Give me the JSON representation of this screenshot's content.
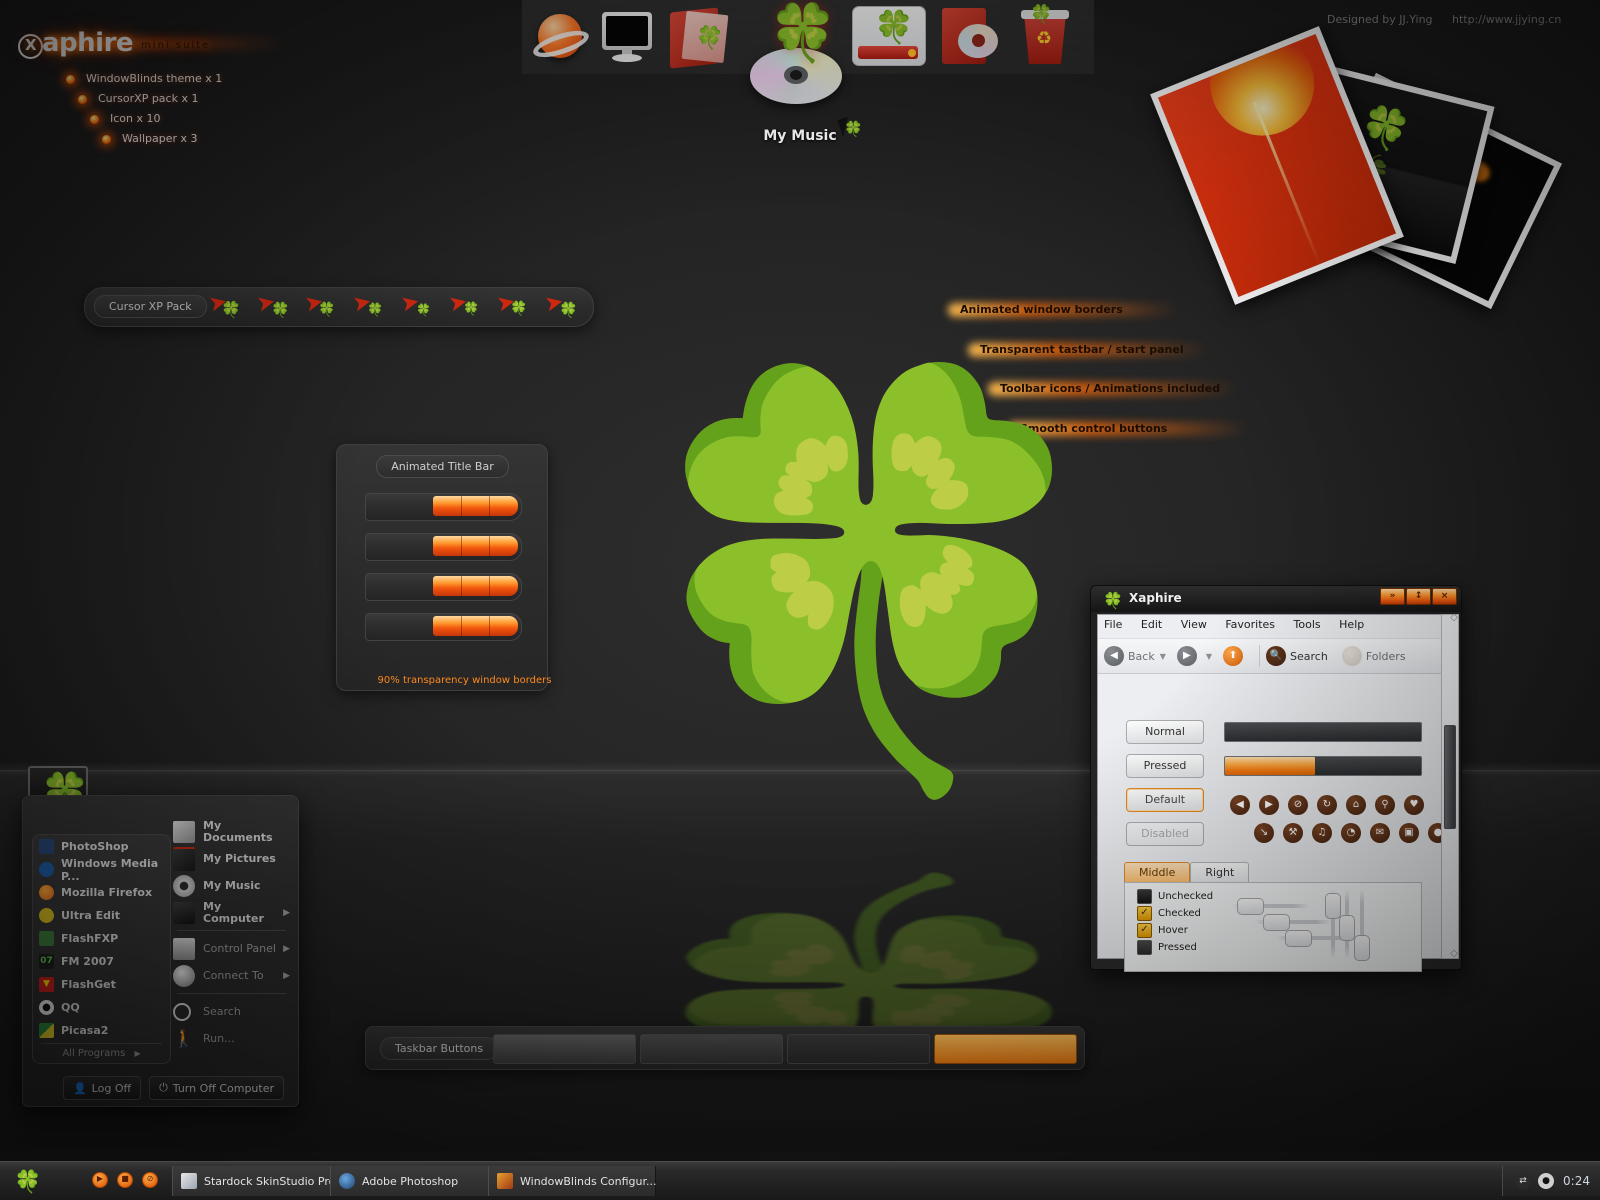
{
  "branding": {
    "logo_mark": "X",
    "logo_text": "aphire",
    "tagline": "mini suite",
    "items": [
      {
        "label": "WindowBlinds theme x 1"
      },
      {
        "label": "CursorXP pack x 1"
      },
      {
        "label": "Icon x 10"
      },
      {
        "label": "Wallpaper x 3"
      }
    ]
  },
  "credits": {
    "designer": "Designed by JJ.Ying",
    "url": "http://www.jjying.cn"
  },
  "icon_strip": {
    "icons": [
      {
        "name": "globe-icon",
        "glyph": "●"
      },
      {
        "name": "monitor-icon",
        "glyph": "■"
      },
      {
        "name": "folder-documents-icon",
        "glyph": "▰"
      },
      {
        "name": "cd-flame-icon",
        "glyph": "●"
      },
      {
        "name": "hard-drive-icon",
        "glyph": "▬"
      },
      {
        "name": "disc-folder-icon",
        "glyph": "●"
      },
      {
        "name": "recycle-bin-icon",
        "glyph": "♻"
      }
    ],
    "selected_label": "My Music"
  },
  "cursor_panel": {
    "title": "Cursor XP Pack",
    "count": 8
  },
  "title_bar_panel": {
    "title": "Animated Title Bar",
    "rows": 4,
    "note": "90% transparency window borders"
  },
  "callouts": [
    {
      "text": "Animated window borders"
    },
    {
      "text": "Transparent tastbar / start panel"
    },
    {
      "text": "Toolbar icons / Animations included"
    },
    {
      "text": "Smooth control buttons"
    }
  ],
  "explorer_window": {
    "title": "Xaphire",
    "caption_buttons": [
      {
        "name": "minimize-button",
        "glyph": "»"
      },
      {
        "name": "maximize-button",
        "glyph": "↕"
      },
      {
        "name": "close-button",
        "glyph": "×"
      }
    ],
    "menu": [
      "File",
      "Edit",
      "View",
      "Favorites",
      "Tools",
      "Help"
    ],
    "toolbar": {
      "back": "Back",
      "search": "Search",
      "folders": "Folders"
    },
    "state_buttons": [
      "Normal",
      "Pressed",
      "Default",
      "Disabled"
    ],
    "progress": {
      "empty_value": 0,
      "filled_value": 46
    },
    "toolbar_icons_row1": [
      {
        "name": "back-icon",
        "glyph": "◀"
      },
      {
        "name": "forward-icon",
        "glyph": "▶"
      },
      {
        "name": "stop-icon",
        "glyph": "⊘"
      },
      {
        "name": "refresh-icon",
        "glyph": "↻"
      },
      {
        "name": "home-icon",
        "glyph": "⌂"
      },
      {
        "name": "search-icon",
        "glyph": "⚲"
      },
      {
        "name": "favorites-icon",
        "glyph": "♥"
      }
    ],
    "toolbar_icons_row2": [
      {
        "name": "history-icon",
        "glyph": "↘"
      },
      {
        "name": "tools-icon",
        "glyph": "⚒"
      },
      {
        "name": "music-icon",
        "glyph": "♫"
      },
      {
        "name": "clock-icon",
        "glyph": "◔"
      },
      {
        "name": "mail-icon",
        "glyph": "✉"
      },
      {
        "name": "window-icon",
        "glyph": "▣"
      },
      {
        "name": "chat-icon",
        "glyph": "●"
      }
    ],
    "tabs": [
      {
        "label": "Middle",
        "active": true
      },
      {
        "label": "Right",
        "active": false
      }
    ],
    "checkbox_states": [
      {
        "label": "Unchecked",
        "checked": false,
        "style": "off"
      },
      {
        "label": "Checked",
        "checked": true,
        "style": "on"
      },
      {
        "label": "Hover",
        "checked": true,
        "style": "hover"
      },
      {
        "label": "Pressed",
        "checked": false,
        "style": "pressed"
      }
    ]
  },
  "start_menu": {
    "programs": [
      {
        "label": "PhotoShop",
        "color": "#2a4a7a"
      },
      {
        "label": "Windows Media P...",
        "color": "#1d5fa8"
      },
      {
        "label": "Mozilla Firefox",
        "color": "#e8651a"
      },
      {
        "label": "Ultra Edit",
        "color": "#d8c020"
      },
      {
        "label": "FlashFXP",
        "color": "#3f7f3f"
      },
      {
        "label": "FM 2007",
        "color": "#1f1f1f"
      },
      {
        "label": "FlashGet",
        "color": "#cf2020"
      },
      {
        "label": "QQ",
        "color": "#f0f0f0"
      },
      {
        "label": "Picasa2",
        "color": "#2e8b3e"
      }
    ],
    "all_programs": "All Programs",
    "places": [
      {
        "label": "My Documents",
        "icon": "documents-icon",
        "arrow": false,
        "dim": false
      },
      {
        "label": "My Pictures",
        "icon": "pictures-icon",
        "arrow": false,
        "dim": false
      },
      {
        "label": "My Music",
        "icon": "music-icon",
        "arrow": false,
        "dim": false
      },
      {
        "label": "My Computer",
        "icon": "computer-icon",
        "arrow": true,
        "dim": false
      }
    ],
    "system": [
      {
        "label": "Control Panel",
        "icon": "control-panel-icon",
        "arrow": true,
        "dim": true
      },
      {
        "label": "Connect To",
        "icon": "connect-to-icon",
        "arrow": true,
        "dim": true
      }
    ],
    "utilities": [
      {
        "label": "Search",
        "icon": "search-icon",
        "arrow": false,
        "dim": true
      },
      {
        "label": "Run...",
        "icon": "run-icon",
        "arrow": false,
        "dim": true
      }
    ],
    "log_off": "Log Off",
    "turn_off": "Turn Off Computer"
  },
  "taskbar_demo": {
    "title": "Taskbar Buttons",
    "buttons": [
      {
        "state": "normal"
      },
      {
        "state": "hover"
      },
      {
        "state": "pressed"
      },
      {
        "state": "active"
      }
    ]
  },
  "taskbar": {
    "quick_launch": [
      {
        "name": "media-play-icon",
        "glyph": "▶"
      },
      {
        "name": "media-stop-icon",
        "glyph": "■"
      },
      {
        "name": "media-mute-icon",
        "glyph": "⊘"
      }
    ],
    "tasks": [
      {
        "label": "Stardock SkinStudio Pro...",
        "color": "#c8cfd8"
      },
      {
        "label": "Adobe Photoshop",
        "color": "#2a4a7a"
      },
      {
        "label": "WindowBlinds Configur...",
        "color": "#c06030"
      }
    ],
    "tray": [
      {
        "name": "network-icon",
        "glyph": "⇄"
      },
      {
        "name": "alien-icon",
        "glyph": "●"
      }
    ],
    "clock": "0:24"
  },
  "colors": {
    "accent": "#ff7a10",
    "accent_deep": "#e02a12",
    "bg": "#242424",
    "panel": "#2e2e2e"
  }
}
